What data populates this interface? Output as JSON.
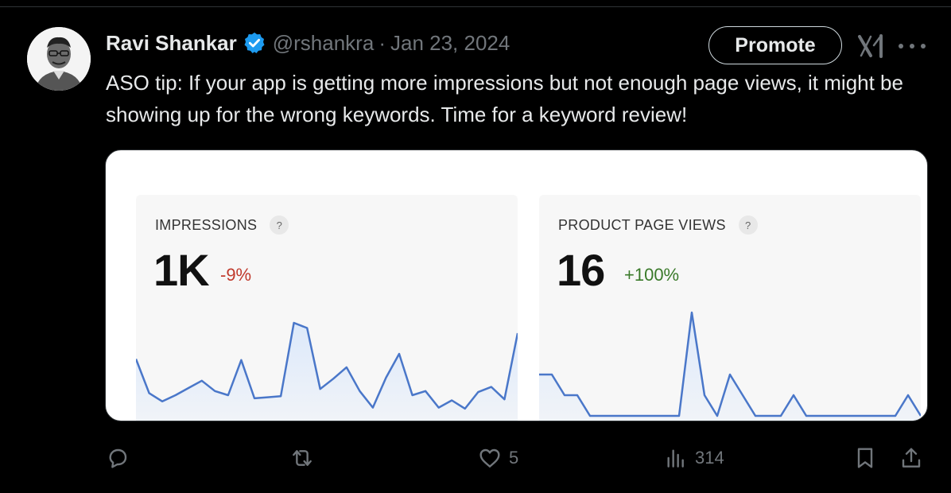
{
  "tweet": {
    "author_name": "Ravi Shankar",
    "handle": "@rshankra",
    "separator": "·",
    "date": "Jan 23, 2024",
    "text": "ASO tip: If your app is getting more impressions but not enough page views, it might be showing up for the wrong keywords. Time for a keyword review!"
  },
  "header_actions": {
    "promote_label": "Promote",
    "grok_icon": "grok-icon",
    "more_icon": "more-icon"
  },
  "media": {
    "metrics": [
      {
        "label": "IMPRESSIONS",
        "help": "?",
        "value": "1K",
        "change": "-9%",
        "change_color": "#c0392b"
      },
      {
        "label": "PRODUCT PAGE VIEWS",
        "help": "?",
        "value": "16",
        "change": "+100%",
        "change_color": "#3a7a2a"
      }
    ],
    "line_color": "#4a77c9",
    "fill_color": "#dbe8fb",
    "sparklines": [
      [
        0.55,
        0.22,
        0.14,
        0.2,
        0.27,
        0.34,
        0.24,
        0.2,
        0.54,
        0.17,
        0.18,
        0.19,
        0.9,
        0.85,
        0.26,
        0.36,
        0.47,
        0.24,
        0.08,
        0.37,
        0.6,
        0.2,
        0.24,
        0.08,
        0.15,
        0.07,
        0.23,
        0.28,
        0.16,
        0.8
      ],
      [
        0.4,
        0.4,
        0.2,
        0.2,
        0.0,
        0.0,
        0.0,
        0.0,
        0.0,
        0.0,
        0.0,
        0.0,
        1.0,
        0.2,
        0.0,
        0.4,
        0.2,
        0.0,
        0.0,
        0.0,
        0.2,
        0.0,
        0.0,
        0.0,
        0.0,
        0.0,
        0.0,
        0.0,
        0.0,
        0.2,
        0.0
      ]
    ]
  },
  "actions": {
    "reply_icon": "reply-icon",
    "retweet_icon": "retweet-icon",
    "like_icon": "like-icon",
    "like_count": "5",
    "views_icon": "views-icon",
    "views_count": "314",
    "bookmark_icon": "bookmark-icon",
    "share_icon": "share-icon"
  }
}
